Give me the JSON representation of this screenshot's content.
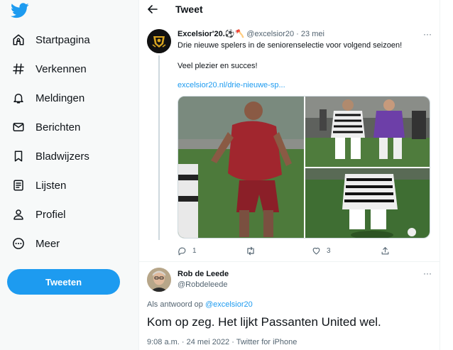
{
  "sidebar": {
    "items": [
      {
        "label": "Startpagina",
        "icon": "home-icon"
      },
      {
        "label": "Verkennen",
        "icon": "hashtag-icon"
      },
      {
        "label": "Meldingen",
        "icon": "bell-icon"
      },
      {
        "label": "Berichten",
        "icon": "mail-icon"
      },
      {
        "label": "Bladwijzers",
        "icon": "bookmark-icon"
      },
      {
        "label": "Lijsten",
        "icon": "list-icon"
      },
      {
        "label": "Profiel",
        "icon": "person-icon"
      },
      {
        "label": "Meer",
        "icon": "more-circle-icon"
      }
    ],
    "tweet_button": "Tweeten"
  },
  "header": {
    "title": "Tweet"
  },
  "tweet": {
    "name": "Excelsior'20.⚽🪓",
    "handle": "@excelsior20",
    "separator": "·",
    "time": "23 mei",
    "text_line1": "Drie nieuwe spelers in de seniorenselectie voor volgend seizoen!",
    "text_line2": "Veel plezier en succes!",
    "link": "excelsior20.nl/drie-nieuwe-sp...",
    "replies": "1",
    "retweets": "",
    "likes": "3"
  },
  "reply": {
    "name": "Rob de Leede",
    "handle": "@Robdeleede",
    "reply_prefix": "Als antwoord op",
    "reply_mention": "@excelsior20",
    "text": "Kom op zeg. Het lijkt Passanten United wel.",
    "meta": "9:08 a.m. · 24 mei 2022 · Twitter for iPhone"
  },
  "colors": {
    "accent": "#1d9bf0",
    "sidebar_bg": "#f7f9f9",
    "text_secondary": "#536471"
  }
}
